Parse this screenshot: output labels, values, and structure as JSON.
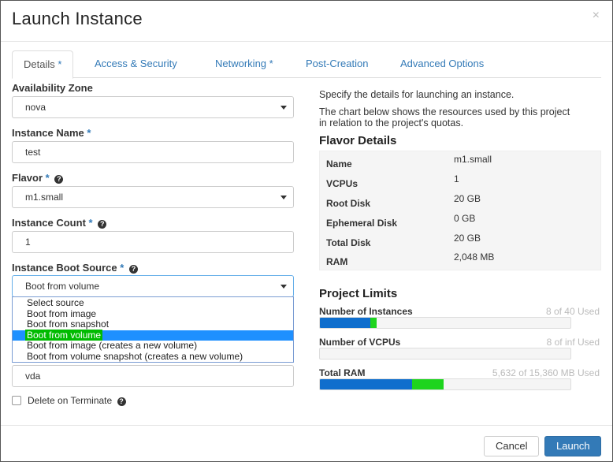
{
  "modal": {
    "title": "Launch Instance",
    "close_symbol": "×"
  },
  "tabs": [
    {
      "label": "Details",
      "required": "*"
    },
    {
      "label": "Access & Security",
      "required": ""
    },
    {
      "label": "Networking",
      "required": "*"
    },
    {
      "label": "Post-Creation",
      "required": ""
    },
    {
      "label": "Advanced Options",
      "required": ""
    }
  ],
  "form": {
    "availability_zone": {
      "label": "Availability Zone",
      "value": "nova"
    },
    "instance_name": {
      "label": "Instance Name",
      "required": "*",
      "value": "test"
    },
    "flavor": {
      "label": "Flavor",
      "required": "*",
      "value": "m1.small"
    },
    "instance_count": {
      "label": "Instance Count",
      "required": "*",
      "value": "1"
    },
    "boot_source": {
      "label": "Instance Boot Source",
      "required": "*",
      "value": "Boot from volume",
      "options": [
        "Select source",
        "Boot from image",
        "Boot from snapshot",
        "Boot from volume",
        "Boot from image (creates a new volume)",
        "Boot from volume snapshot (creates a new volume)"
      ],
      "selected_index": 3
    },
    "device_name": {
      "value": "vda"
    },
    "delete_on_terminate": {
      "label": "Delete on Terminate",
      "checked": false
    }
  },
  "info": {
    "intro": "Specify the details for launching an instance.",
    "chart_note_line1": "The chart below shows the resources used by this project",
    "chart_note_line2": "in relation to the project's quotas.",
    "flavor_details_title": "Flavor Details",
    "flavor_rows": [
      {
        "key": "Name",
        "value": "m1.small"
      },
      {
        "key": "VCPUs",
        "value": "1"
      },
      {
        "key": "Root Disk",
        "value": "20 GB"
      },
      {
        "key": "Ephemeral Disk",
        "value": "0 GB"
      },
      {
        "key": "Total Disk",
        "value": "20 GB"
      },
      {
        "key": "RAM",
        "value": "2,048 MB"
      }
    ],
    "project_limits_title": "Project Limits",
    "limits": [
      {
        "name": "Number of Instances",
        "value": "8 of 40 Used",
        "used_fraction": 0.2,
        "added_fraction": 0.025
      },
      {
        "name": "Number of VCPUs",
        "value": "8 of inf Used",
        "used_fraction": 0,
        "added_fraction": 0
      },
      {
        "name": "Total RAM",
        "value": "5,632 of 15,360 MB Used",
        "used_fraction": 0.367,
        "added_fraction": 0.128
      }
    ]
  },
  "footer": {
    "cancel_label": "Cancel",
    "launch_label": "Launch"
  },
  "colors": {
    "accent": "#337ab7",
    "bar_used": "#0f6ecd",
    "bar_added": "#1ed41e",
    "highlight": "#1e90ff"
  },
  "icons": {
    "help": "question-circle-icon",
    "caret": "caret-down-icon"
  }
}
